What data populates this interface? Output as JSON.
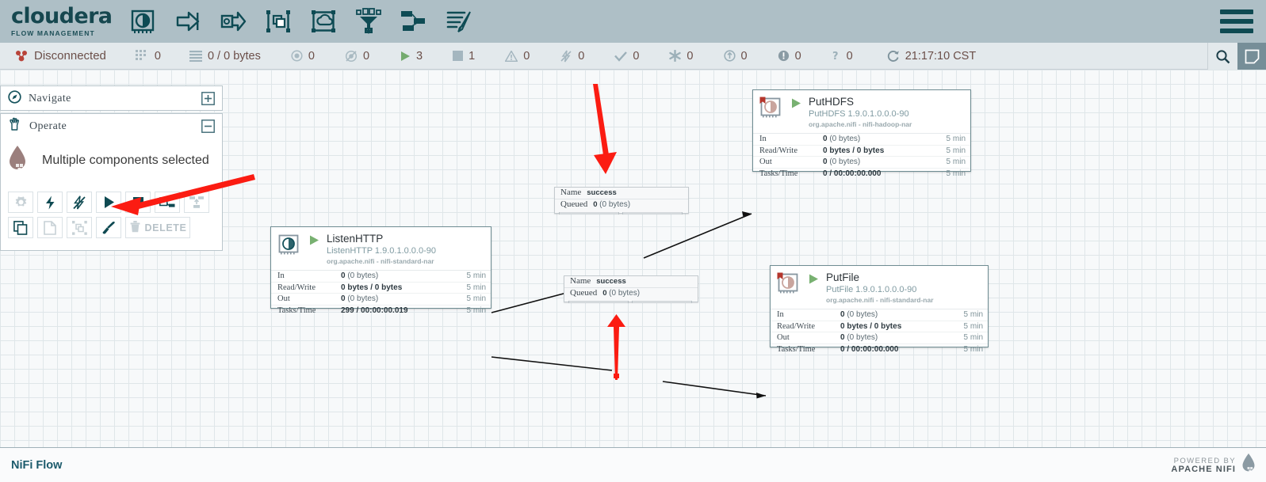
{
  "header": {
    "brand_name": "cloudera",
    "brand_sub": "FLOW MANAGEMENT",
    "toolbar_icons": [
      {
        "name": "processor-icon",
        "title": "Processor"
      },
      {
        "name": "input-port-icon",
        "title": "Input Port"
      },
      {
        "name": "output-port-icon",
        "title": "Output Port"
      },
      {
        "name": "process-group-icon",
        "title": "Process Group"
      },
      {
        "name": "remote-process-group-icon",
        "title": "Remote Process Group"
      },
      {
        "name": "funnel-icon",
        "title": "Funnel"
      },
      {
        "name": "template-icon",
        "title": "Template"
      },
      {
        "name": "label-icon",
        "title": "Label"
      }
    ],
    "menu_label": "Global Menu"
  },
  "status_bar": {
    "connection_status": "Disconnected",
    "items": [
      {
        "icon": "cluster-icon",
        "value": "0"
      },
      {
        "icon": "queue-icon",
        "value": "0 / 0 bytes"
      },
      {
        "icon": "transmitting-icon",
        "value": "0"
      },
      {
        "icon": "not-transmitting-icon",
        "value": "0"
      },
      {
        "icon": "running-icon",
        "value": "3"
      },
      {
        "icon": "stopped-icon",
        "value": "1"
      },
      {
        "icon": "invalid-icon",
        "value": "0"
      },
      {
        "icon": "disabled-icon",
        "value": "0"
      },
      {
        "icon": "up-to-date-icon",
        "value": "0"
      },
      {
        "icon": "locally-modified-icon",
        "value": "0"
      },
      {
        "icon": "stale-icon",
        "value": "0"
      },
      {
        "icon": "sync-failure-icon",
        "value": "0"
      }
    ],
    "refresh_time": "21:17:10 CST",
    "search_placeholder": "Search",
    "buttons": {
      "search": "search-icon",
      "note": "note-icon"
    }
  },
  "navigate_panel": {
    "title": "Navigate",
    "icon": "compass-icon",
    "toggle": "expand-plus"
  },
  "operate_panel": {
    "title": "Operate",
    "icon": "hand-icon",
    "toggle": "collapse-minus",
    "selection_label": "Multiple components selected",
    "selection_icon": "nifi-drop-icon",
    "actions_row1": [
      {
        "name": "configure-button",
        "icon": "gear-icon",
        "enabled": false
      },
      {
        "name": "enable-button",
        "icon": "bolt-icon",
        "enabled": true
      },
      {
        "name": "disable-button",
        "icon": "bolt-slash-icon",
        "enabled": true
      },
      {
        "name": "start-button",
        "icon": "play-icon",
        "enabled": true
      },
      {
        "name": "stop-button",
        "icon": "stop-icon",
        "enabled": true
      },
      {
        "name": "copy-template-button",
        "icon": "template-save-icon",
        "enabled": true
      },
      {
        "name": "upload-template-button",
        "icon": "template-upload-icon",
        "enabled": false
      }
    ],
    "actions_row2": [
      {
        "name": "copy-button",
        "icon": "copy-icon",
        "enabled": true
      },
      {
        "name": "paste-button",
        "icon": "paste-icon",
        "enabled": false
      },
      {
        "name": "group-button",
        "icon": "group-icon",
        "enabled": false
      },
      {
        "name": "change-color-button",
        "icon": "paintbrush-icon",
        "enabled": true
      },
      {
        "name": "delete-button",
        "icon": "trash-icon",
        "label": "DELETE",
        "enabled": false
      }
    ]
  },
  "processors": [
    {
      "id": "listenhttp",
      "name": "ListenHTTP",
      "type": "ListenHTTP 1.9.0.1.0.0.0-90",
      "bundle": "org.apache.nifi - nifi-standard-nar",
      "state": "running",
      "bulletin": false,
      "stats": [
        {
          "key": "In",
          "value": "0",
          "dim": "(0 bytes)",
          "time": "5 min"
        },
        {
          "key": "Read/Write",
          "value": "0 bytes / 0 bytes",
          "dim": "",
          "time": "5 min"
        },
        {
          "key": "Out",
          "value": "0",
          "dim": "(0 bytes)",
          "time": "5 min"
        },
        {
          "key": "Tasks/Time",
          "value": "299 / 00:00:00.019",
          "dim": "",
          "time": "5 min"
        }
      ]
    },
    {
      "id": "puthdfs",
      "name": "PutHDFS",
      "type": "PutHDFS 1.9.0.1.0.0.0-90",
      "bundle": "org.apache.nifi - nifi-hadoop-nar",
      "state": "running",
      "bulletin": true,
      "stats": [
        {
          "key": "In",
          "value": "0",
          "dim": "(0 bytes)",
          "time": "5 min"
        },
        {
          "key": "Read/Write",
          "value": "0 bytes / 0 bytes",
          "dim": "",
          "time": "5 min"
        },
        {
          "key": "Out",
          "value": "0",
          "dim": "(0 bytes)",
          "time": "5 min"
        },
        {
          "key": "Tasks/Time",
          "value": "0 / 00:00:00.000",
          "dim": "",
          "time": "5 min"
        }
      ]
    },
    {
      "id": "putfile",
      "name": "PutFile",
      "type": "PutFile 1.9.0.1.0.0.0-90",
      "bundle": "org.apache.nifi - nifi-standard-nar",
      "state": "running",
      "bulletin": true,
      "stats": [
        {
          "key": "In",
          "value": "0",
          "dim": "(0 bytes)",
          "time": "5 min"
        },
        {
          "key": "Read/Write",
          "value": "0 bytes / 0 bytes",
          "dim": "",
          "time": "5 min"
        },
        {
          "key": "Out",
          "value": "0",
          "dim": "(0 bytes)",
          "time": "5 min"
        },
        {
          "key": "Tasks/Time",
          "value": "0 / 00:00:00.000",
          "dim": "",
          "time": "5 min"
        }
      ]
    }
  ],
  "connections": [
    {
      "id": "conn-hdfs",
      "name_key": "Name",
      "name_value": "success",
      "queued_key": "Queued",
      "queued_value": "0",
      "queued_dim": "(0 bytes)"
    },
    {
      "id": "conn-file",
      "name_key": "Name",
      "name_value": "success",
      "queued_key": "Queued",
      "queued_value": "0",
      "queued_dim": "(0 bytes)"
    }
  ],
  "annotations": {
    "arrow_color": "#fb1c12",
    "arrows": [
      {
        "name": "annotation-arrow-start-button",
        "direction": "down-left"
      },
      {
        "name": "annotation-arrow-connection-top",
        "direction": "down"
      },
      {
        "name": "annotation-arrow-connection-bottom",
        "direction": "up"
      }
    ]
  },
  "footer": {
    "breadcrumb": "NiFi Flow",
    "powered_by_line1": "POWERED BY",
    "powered_by_line2": "APACHE NIFI",
    "drop_icon": "nifi-drop-icon"
  },
  "colors": {
    "topbar": "#aebfc6",
    "statusbar": "#e3e9ec",
    "accent_teal": "#0f4a52",
    "canvas": "#f7f9fa",
    "grid": "#dfe6e9",
    "annotation_red": "#fb1c12"
  }
}
